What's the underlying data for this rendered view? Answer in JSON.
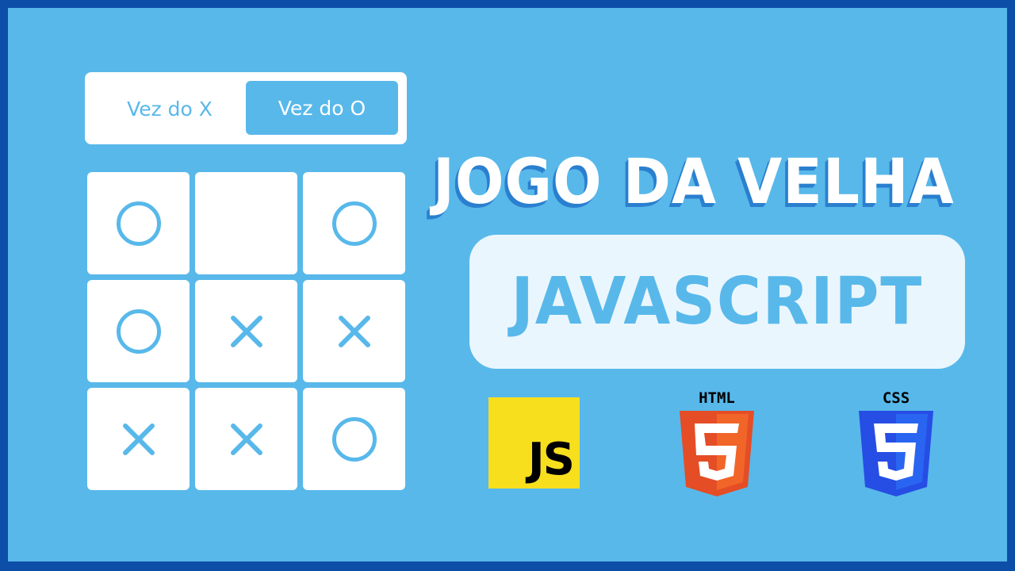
{
  "turn_toggle": {
    "x_label": "Vez do X",
    "o_label": "Vez do O",
    "active": "O"
  },
  "board": {
    "cells": [
      "O",
      "",
      "O",
      "O",
      "X",
      "X",
      "X",
      "X",
      "O"
    ]
  },
  "title": "JOGO DA VELHA",
  "subtitle": "JAVASCRIPT",
  "logos": {
    "js": {
      "label": "JS",
      "icon": "javascript-logo-icon",
      "color": "#f7df1e"
    },
    "html": {
      "label": "HTML",
      "icon": "html5-logo-icon",
      "color": "#e44d26"
    },
    "css": {
      "label": "CSS",
      "icon": "css3-logo-icon",
      "color": "#264de4"
    }
  },
  "colors": {
    "background": "#58b8ea",
    "border": "#0c4ea8",
    "title_shadow": "#2a7fcf"
  }
}
